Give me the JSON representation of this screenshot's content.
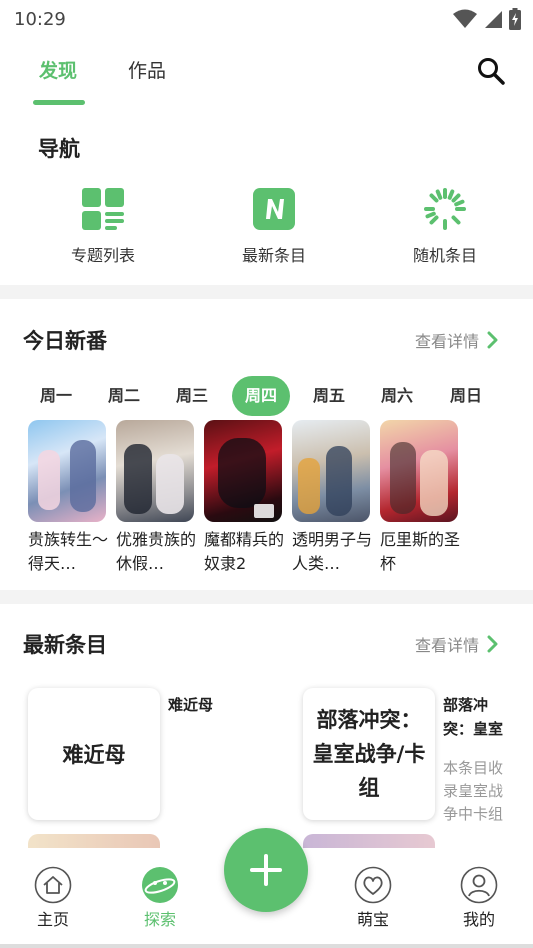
{
  "status": {
    "time": "10:29"
  },
  "top_tabs": {
    "discover": "发现",
    "works": "作品"
  },
  "nav": {
    "title": "导航",
    "items": [
      {
        "label": "专题列表",
        "icon": "grid-list-icon"
      },
      {
        "label": "最新条目",
        "icon": "new-badge-icon"
      },
      {
        "label": "随机条目",
        "icon": "loading-spinner-icon"
      }
    ]
  },
  "today": {
    "title": "今日新番",
    "see_more": "查看详情",
    "weekdays": [
      "周一",
      "周二",
      "周三",
      "周四",
      "周五",
      "周六",
      "周日"
    ],
    "active_weekday": "周四",
    "anime": [
      {
        "title": "贵族转生～得天…"
      },
      {
        "title": "优雅贵族的休假…"
      },
      {
        "title": "魔都精兵的奴隶2"
      },
      {
        "title": "透明男子与人类…"
      },
      {
        "title": "厄里斯的圣杯"
      }
    ]
  },
  "latest": {
    "title": "最新条目",
    "see_more": "查看详情",
    "entries": [
      {
        "card_text": "难近母",
        "side_title": "难近母",
        "desc": ""
      },
      {
        "card_text": "部落冲突：皇室战争/卡组",
        "side_title": "部落冲突：皇室战争/卡",
        "desc": "本条目收录皇室战争中卡组史上留下"
      }
    ]
  },
  "bottom_nav": {
    "home": "主页",
    "explore": "探索",
    "cute": "萌宝",
    "mine": "我的",
    "fab_icon": "plus-icon"
  },
  "colors": {
    "accent": "#5cc06f"
  }
}
